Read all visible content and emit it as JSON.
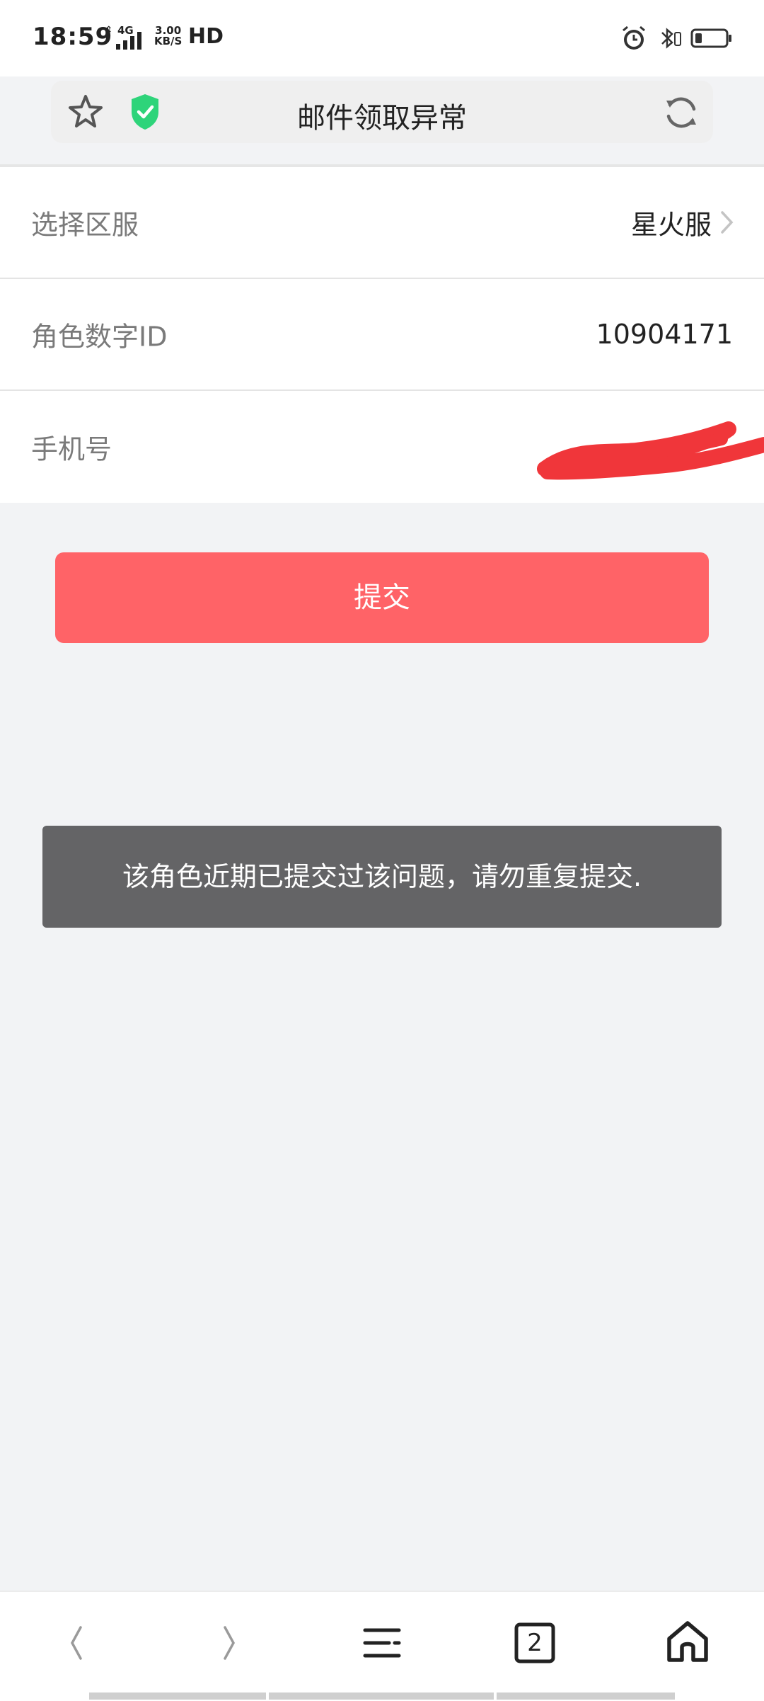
{
  "status_bar": {
    "time": "18:59",
    "network_type": "4G",
    "speed_value": "3.00",
    "speed_unit": "KB/S",
    "hd_label": "HD"
  },
  "url_bar": {
    "title": "邮件领取异常",
    "shield_color": "#2ed47a"
  },
  "form": {
    "rows": [
      {
        "label": "选择区服",
        "value": "星火服"
      },
      {
        "label": "角色数字ID",
        "value": "10904171"
      },
      {
        "label": "手机号",
        "value": ""
      }
    ]
  },
  "submit_label": "提交",
  "toast_message": "该角色近期已提交过该问题，请勿重复提交.",
  "bottom_nav": {
    "tab_count": "2"
  },
  "colors": {
    "accent": "#ff6367",
    "toast_bg": "#646466",
    "redaction": "#f0363a"
  }
}
